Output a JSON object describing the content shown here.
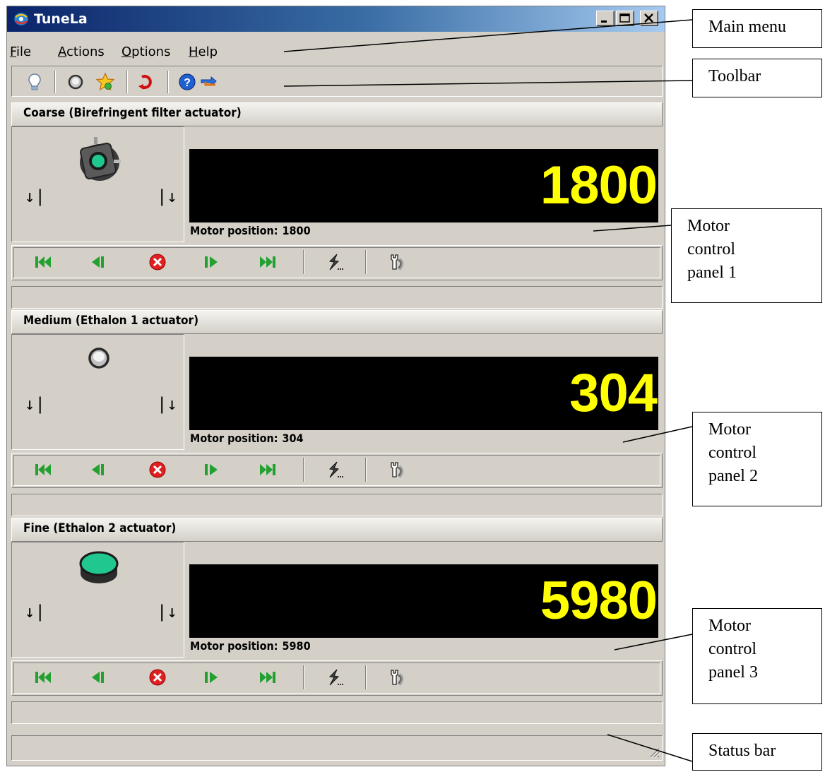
{
  "window": {
    "title": "TuneLa"
  },
  "menu": [
    {
      "accel": "F",
      "rest": "ile"
    },
    {
      "accel": "A",
      "rest": "ctions"
    },
    {
      "accel": "O",
      "rest": "ptions"
    },
    {
      "accel": "H",
      "rest": "elp"
    }
  ],
  "toolbar": {
    "icons": [
      "lightbulb-icon",
      "lens-icon",
      "star-icon",
      "undo-icon",
      "help-icon",
      "transfer-icon"
    ]
  },
  "panels": [
    {
      "title": "Coarse (Birefringent filter actuator)",
      "value": "1800",
      "position_label": "Motor position:",
      "position_value": "1800",
      "actuator": "birefringent-filter"
    },
    {
      "title": "Medium (Ethalon 1 actuator)",
      "value": "304",
      "position_label": "Motor position:",
      "position_value": "304",
      "actuator": "ethalon-1"
    },
    {
      "title": "Fine (Ethalon 2 actuator)",
      "value": "5980",
      "position_label": "Motor position:",
      "position_value": "5980",
      "actuator": "ethalon-2"
    }
  ],
  "limits": {
    "left": "↓|",
    "right": "|↓"
  },
  "motor_buttons": [
    "go-to-start-icon",
    "step-back-icon",
    "stop-icon",
    "step-forward-icon",
    "go-to-end-icon",
    "goto-position-icon",
    "settings-icon"
  ],
  "annotations": {
    "main_menu": "Main menu",
    "toolbar": "Toolbar",
    "panel1": [
      "Motor",
      "control",
      "panel 1"
    ],
    "panel2": [
      "Motor",
      "control",
      "panel 2"
    ],
    "panel3": [
      "Motor",
      "control",
      "panel 3"
    ],
    "status_bar": "Status bar"
  },
  "colors": {
    "title_gradient_start": "#0a246a",
    "display_bg": "#000000",
    "display_text": "#ffff00",
    "window_face": "#d4d0c8",
    "nav_green": "#22a030",
    "stop_red": "#e02020"
  }
}
